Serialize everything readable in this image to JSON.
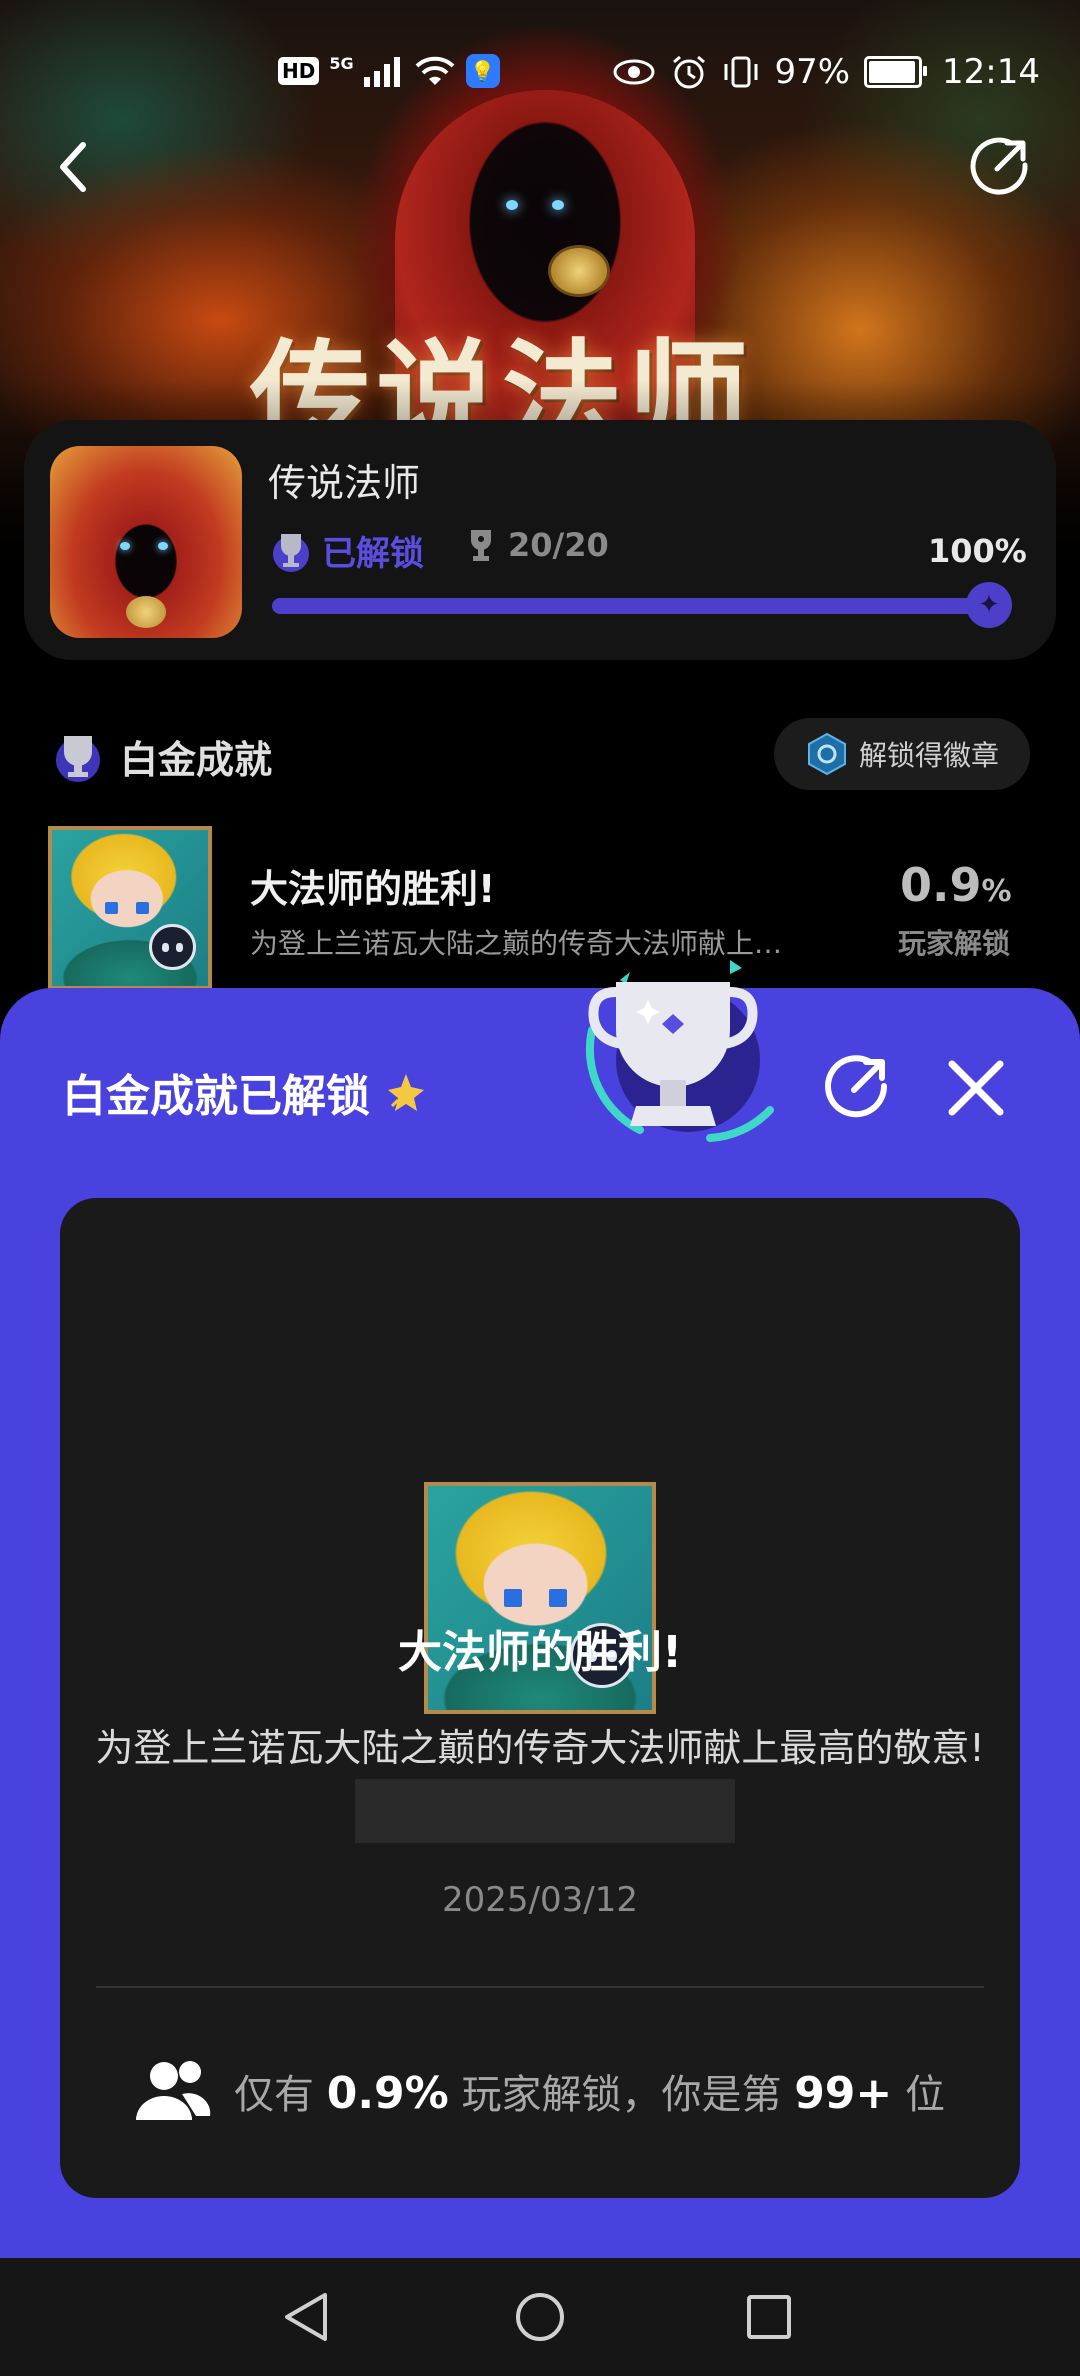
{
  "status_bar": {
    "network": "5G",
    "hd": "HD",
    "battery_percent": "97%",
    "battery_level": 0.97,
    "time": "12:14"
  },
  "hero": {
    "title_art": "传说法师"
  },
  "game": {
    "title": "传说法师",
    "unlocked_label": "已解锁",
    "trophy_count": "20/20",
    "percent": "100%",
    "progress": 1.0
  },
  "section": {
    "title": "白金成就",
    "badge_button": "解锁得徽章"
  },
  "achievement_row": {
    "title": "大法师的胜利!",
    "description": "为登上兰诺瓦大陆之巅的传奇大法师献上…",
    "percent": "0.9",
    "percent_unit": "%",
    "percent_label": "玩家解锁"
  },
  "sheet": {
    "title": "白金成就已解锁",
    "achievement_title": "大法师的胜利!",
    "description": "为登上兰诺瓦大陆之巅的传奇大法师献上最高的敬意!",
    "date": "2025/03/12",
    "stat_prefix": "仅有",
    "stat_percent": "0.9%",
    "stat_middle": "玩家解锁，你是第",
    "stat_rank": "99+",
    "stat_suffix": "位"
  },
  "icons": {
    "back": "back-chevron-icon",
    "share": "share-icon",
    "close": "close-icon",
    "trophy": "trophy-icon",
    "users": "users-icon"
  },
  "colors": {
    "accent": "#4a42df",
    "progress": "#4c3fc9",
    "card": "#1a1a1a"
  }
}
